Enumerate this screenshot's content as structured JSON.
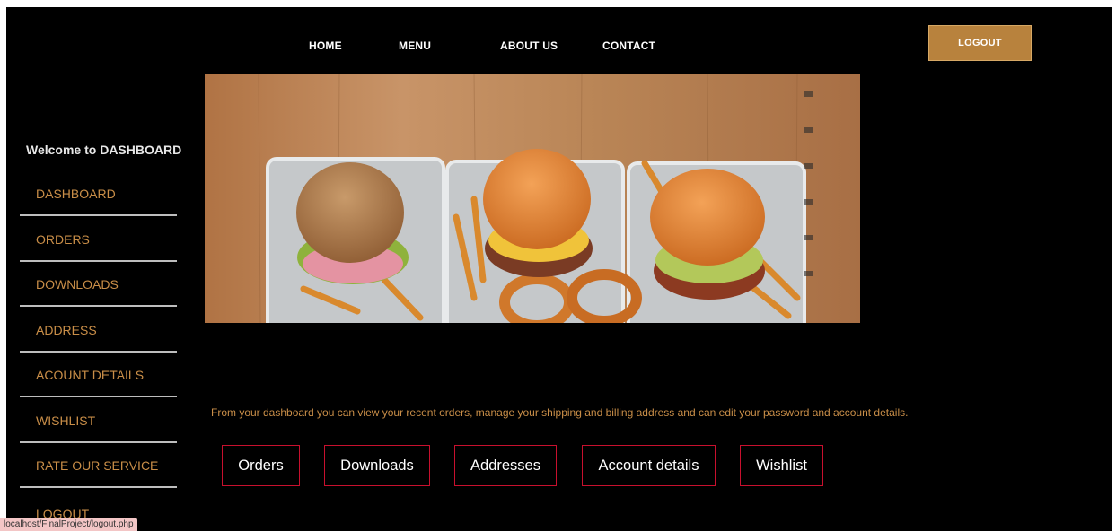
{
  "nav": {
    "items": [
      {
        "label": "HOME"
      },
      {
        "label": "MENU"
      },
      {
        "label": "ABOUT US"
      },
      {
        "label": "CONTACT"
      }
    ],
    "logout_label": "LOGOUT"
  },
  "sidebar": {
    "welcome": "Welcome to DASHBOARD",
    "items": [
      {
        "label": "DASHBOARD"
      },
      {
        "label": "ORDERS"
      },
      {
        "label": "DOWNLOADS"
      },
      {
        "label": "ADDRESS"
      },
      {
        "label": "ACOUNT DETAILS"
      },
      {
        "label": "WISHLIST"
      },
      {
        "label": "RATE OUR SERVICE"
      },
      {
        "label": "LOGOUT"
      }
    ]
  },
  "main": {
    "intro": "From your dashboard you can view your recent orders, manage your shipping and billing address and can edit your password and account details.",
    "tiles": [
      {
        "label": "Orders"
      },
      {
        "label": "Downloads"
      },
      {
        "label": "Addresses"
      },
      {
        "label": "Account details"
      },
      {
        "label": "Wishlist"
      }
    ]
  },
  "status_bar": {
    "url": "localhost/FinalProject/logout.php"
  },
  "colors": {
    "background": "#000000",
    "accent": "#c98e48",
    "logout_button": "#b8823d",
    "tile_border": "#c8102e"
  }
}
